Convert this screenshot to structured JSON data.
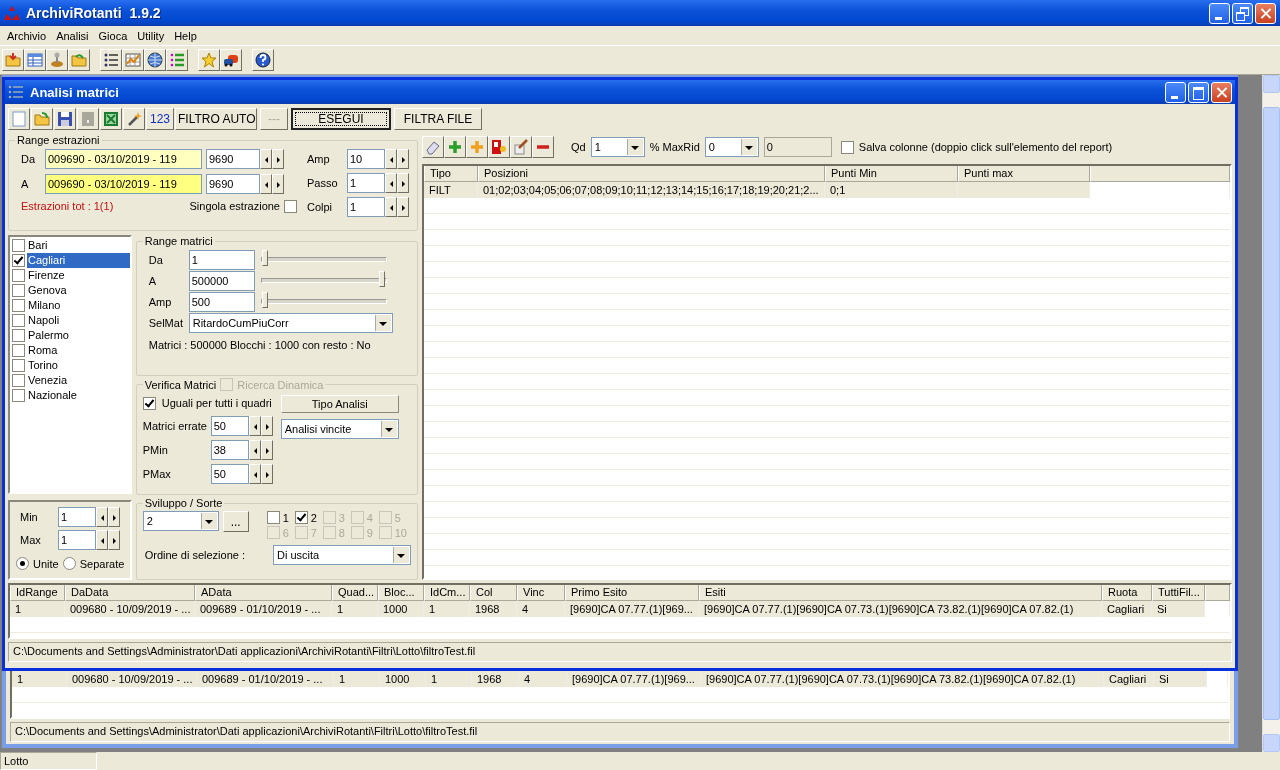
{
  "app": {
    "title": "ArchiviRotanti  1.9.2"
  },
  "menu": [
    "Archivio",
    "Analisi",
    "Gioca",
    "Utility",
    "Help"
  ],
  "child_window": {
    "title": "Analisi matrici"
  },
  "child_toolbar": {
    "number_button": "123",
    "buttons": [
      {
        "label": "FILTRO AUTO",
        "disabled": false,
        "focused": false
      },
      {
        "label": "---",
        "disabled": true,
        "focused": false
      },
      {
        "label": "ESEGUI",
        "disabled": false,
        "focused": true
      },
      {
        "label": "FILTRA FILE",
        "disabled": false,
        "focused": false
      }
    ]
  },
  "range_estrazioni": {
    "title": "Range estrazioni",
    "rows": [
      {
        "label": "Da",
        "date": "009690 - 03/10/2019 - 119",
        "number": "9690",
        "focused": false
      },
      {
        "label": "A",
        "date": "009690 - 03/10/2019 - 119",
        "number": "9690",
        "focused": true
      }
    ],
    "params": [
      {
        "label": "Amp",
        "value": "10"
      },
      {
        "label": "Passo",
        "value": "1"
      },
      {
        "label": "Colpi",
        "value": "1"
      }
    ],
    "total": "Estrazioni tot : 1(1)",
    "single": {
      "label": "Singola estrazione",
      "checked": false
    }
  },
  "cities": [
    {
      "name": "Bari",
      "checked": false,
      "selected": false
    },
    {
      "name": "Cagliari",
      "checked": true,
      "selected": true
    },
    {
      "name": "Firenze",
      "checked": false,
      "selected": false
    },
    {
      "name": "Genova",
      "checked": false,
      "selected": false
    },
    {
      "name": "Milano",
      "checked": false,
      "selected": false
    },
    {
      "name": "Napoli",
      "checked": false,
      "selected": false
    },
    {
      "name": "Palermo",
      "checked": false,
      "selected": false
    },
    {
      "name": "Roma",
      "checked": false,
      "selected": false
    },
    {
      "name": "Torino",
      "checked": false,
      "selected": false
    },
    {
      "name": "Venezia",
      "checked": false,
      "selected": false
    },
    {
      "name": "Nazionale",
      "checked": false,
      "selected": false
    }
  ],
  "range_matrici": {
    "title": "Range matrici",
    "rows": [
      {
        "label": "Da",
        "value": "1",
        "level": 0
      },
      {
        "label": "A",
        "value": "500000",
        "level": 1
      },
      {
        "label": "Amp",
        "value": "500",
        "level": 0
      }
    ],
    "selmat": {
      "label": "SelMat",
      "value": "RitardoCumPiuCorr"
    },
    "summary": "Matrici : 500000 Blocchi : 1000 con resto : No"
  },
  "verifica": {
    "title": "Verifica Matrici",
    "dynamic": {
      "label": "Ricerca Dinamica",
      "checked": false,
      "disabled": true
    },
    "same": {
      "label": "Uguali per tutti i quadri",
      "checked": true
    },
    "params": [
      {
        "label": "Matrici errate",
        "value": "50"
      },
      {
        "label": "PMin",
        "value": "38"
      },
      {
        "label": "PMax",
        "value": "50"
      }
    ],
    "tipo_label": "Tipo Analisi",
    "tipo_value": "Analisi vincite"
  },
  "minmax": {
    "rows": [
      {
        "label": "Min",
        "value": "1"
      },
      {
        "label": "Max",
        "value": "1"
      }
    ],
    "options": [
      {
        "label": "Unite",
        "selected": true
      },
      {
        "label": "Separate",
        "selected": false
      }
    ]
  },
  "sviluppo": {
    "title": "Sviluppo / Sorte",
    "value": "2",
    "more": "...",
    "sorts": [
      {
        "label": "1",
        "checked": false,
        "disabled": false
      },
      {
        "label": "2",
        "checked": true,
        "disabled": false
      },
      {
        "label": "3",
        "checked": false,
        "disabled": true
      },
      {
        "label": "4",
        "checked": false,
        "disabled": true
      },
      {
        "label": "5",
        "checked": false,
        "disabled": true
      },
      {
        "label": "6",
        "checked": false,
        "disabled": true
      },
      {
        "label": "7",
        "checked": false,
        "disabled": true
      },
      {
        "label": "8",
        "checked": false,
        "disabled": true
      },
      {
        "label": "9",
        "checked": false,
        "disabled": true
      },
      {
        "label": "10",
        "checked": false,
        "disabled": true
      }
    ],
    "order_label": "Ordine di selezione :",
    "order_value": "Di uscita"
  },
  "report_toolbar": {
    "qd_label": "Qd",
    "qd_value": "1",
    "maxrid_label": "% MaxRid",
    "maxrid_value": "0",
    "readonly_value": "0",
    "save": {
      "label": "Salva colonne (doppio click sull'elemento del report)",
      "checked": false
    }
  },
  "report": {
    "columns": [
      "Tipo",
      "Posizioni",
      "Punti Min",
      "Punti max"
    ],
    "rows": [
      [
        "FILT",
        "01;02;03;04;05;06;07;08;09;10;11;12;13;14;15;16;17;18;19;20;21;2...",
        "0;1"
      ]
    ]
  },
  "results": {
    "columns": [
      "IdRange",
      "DaData",
      "AData",
      "Quad...",
      "Bloc...",
      "IdCm...",
      "Col",
      "Vinc",
      "Primo Esito",
      "Esiti",
      "Ruota",
      "TuttiFil..."
    ],
    "rows": [
      [
        "1",
        "009680 - 10/09/2019 - ...",
        "009689 - 01/10/2019 - ...",
        "1",
        "1000",
        "1",
        "1968",
        "4",
        "[9690]CA 07.77.(1)[969...",
        "[9690]CA 07.77.(1)[9690]CA 07.73.(1)[9690]CA 73.82.(1)[9690]CA 07.82.(1)",
        "Cagliari",
        "Si"
      ]
    ]
  },
  "path": "C:\\Documents and Settings\\Administrator\\Dati applicazioni\\ArchiviRotanti\\Filtri\\Lotto\\filtroTest.fil",
  "back_window": {
    "rows": [
      [
        "1",
        "009680 - 10/09/2019 - ...",
        "009689 - 01/10/2019 - ...",
        "1",
        "1000",
        "1",
        "1968",
        "4",
        "[9690]CA 07.77.(1)[969...",
        "[9690]CA 07.77.(1)[9690]CA 07.73.(1)[9690]CA 73.82.(1)[9690]CA 07.82.(1)",
        "Cagliari",
        "Si"
      ]
    ],
    "path": "C:\\Documents and Settings\\Administrator\\Dati applicazioni\\ArchiviRotanti\\Filtri\\Lotto\\filtroTest.fil"
  },
  "status_bar": [
    "Lotto"
  ]
}
